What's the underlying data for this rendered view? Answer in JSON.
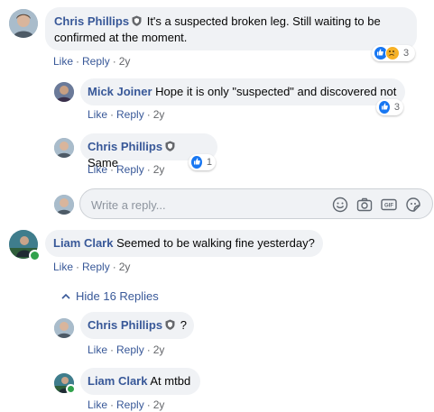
{
  "comments": [
    {
      "author": "Chris Phillips",
      "text_line1": "It's a suspected broken leg. Still waiting to be",
      "text_line2": "confirmed at the moment.",
      "like": "Like",
      "reply": "Reply",
      "age": "2y",
      "reaction_count": "3"
    },
    {
      "author": "Mick Joiner",
      "text": "Hope it is only \"suspected\" and discovered not",
      "like": "Like",
      "reply": "Reply",
      "age": "2y",
      "reaction_count": "3"
    },
    {
      "author": "Chris Phillips",
      "text": "Same",
      "like": "Like",
      "reply": "Reply",
      "age": "2y",
      "reaction_count": "1"
    },
    {
      "author": "Liam Clark",
      "text": "Seemed to be walking fine yesterday?",
      "like": "Like",
      "reply": "Reply",
      "age": "2y"
    },
    {
      "author": "Chris Phillips",
      "text": "?",
      "like": "Like",
      "reply": "Reply",
      "age": "2y"
    },
    {
      "author": "Liam Clark",
      "text": "At mtbd",
      "like": "Like",
      "reply": "Reply",
      "age": "2y"
    }
  ],
  "reply_box": {
    "placeholder": "Write a reply...",
    "icons": [
      "emoji-icon",
      "camera-icon",
      "gif-icon",
      "sticker-icon"
    ]
  },
  "hide_replies": "Hide 16 Replies",
  "colors": {
    "link": "#385898",
    "bubble": "#f0f2f5",
    "meta": "#65676b",
    "like_blue": "#1877f2",
    "online_green": "#31a24c"
  }
}
